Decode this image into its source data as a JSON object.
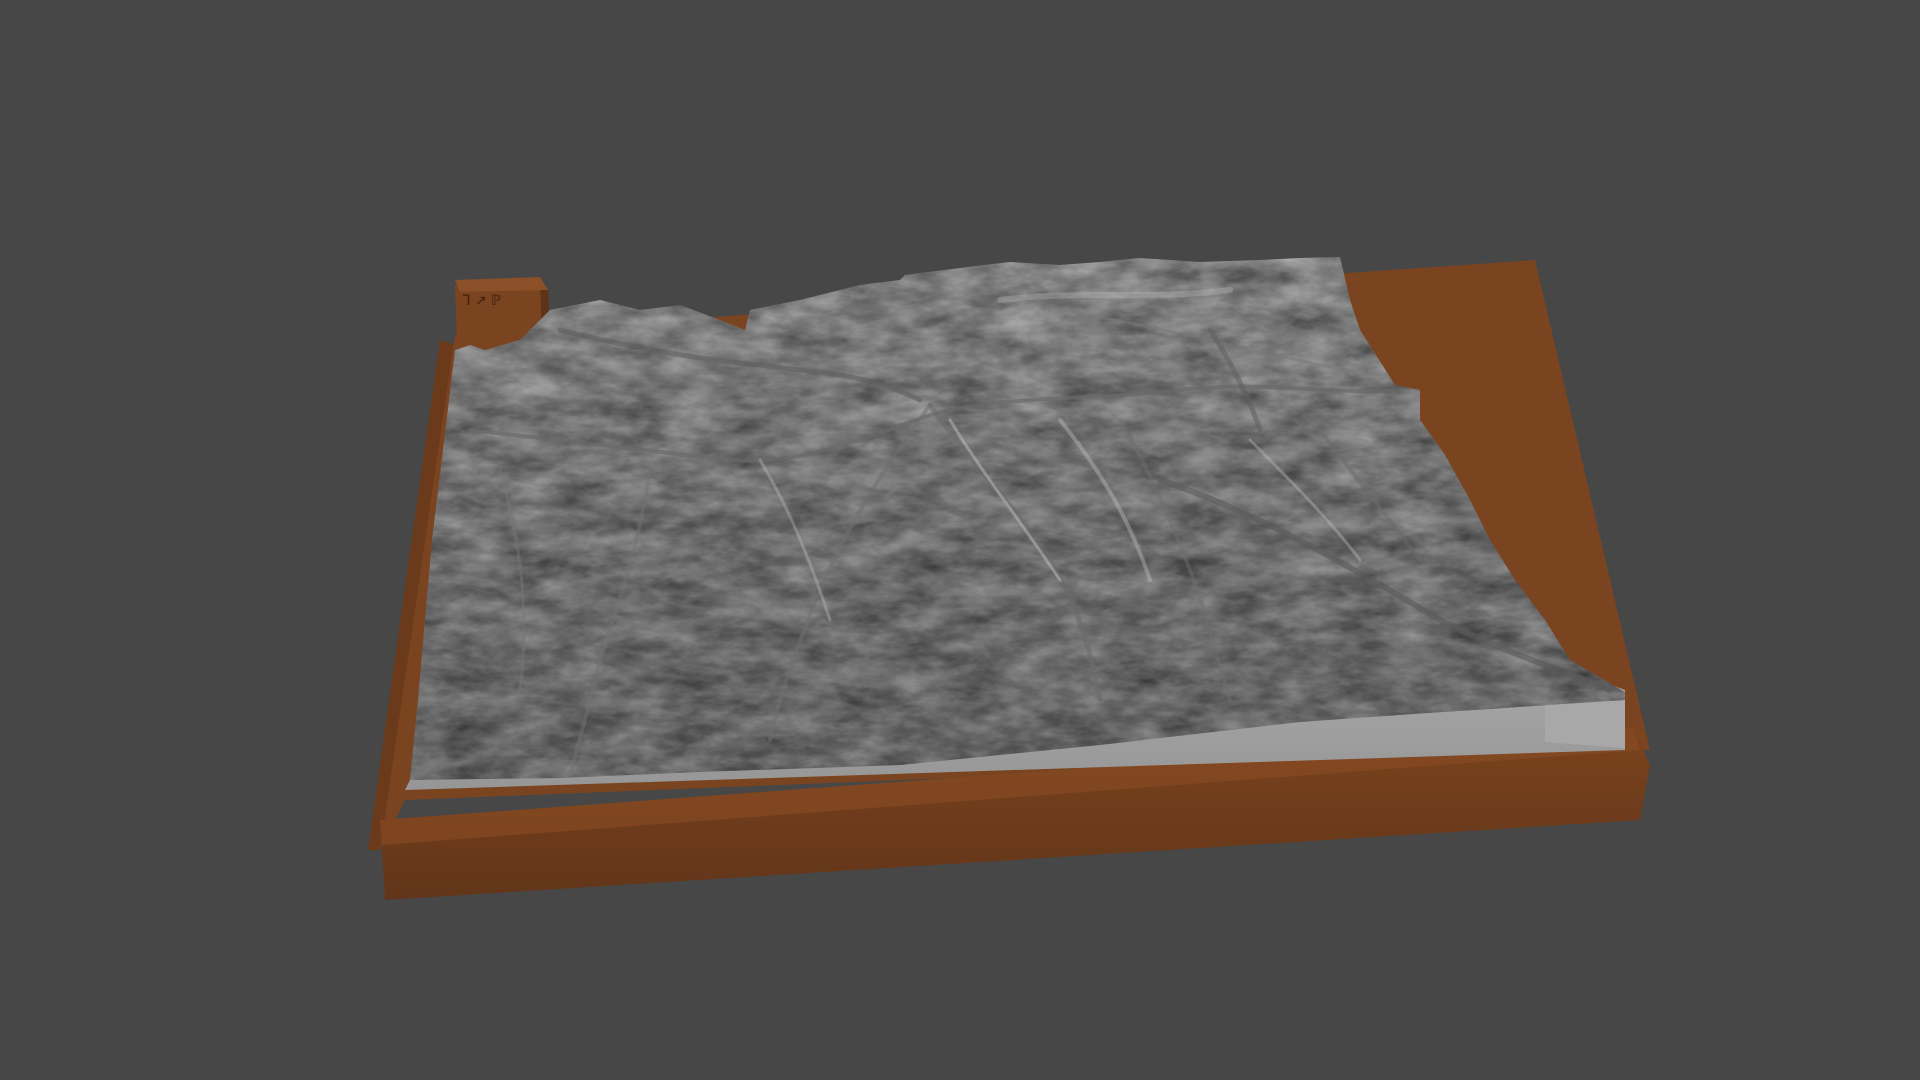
{
  "scene": {
    "description_visible_text": "",
    "background_color": "#474747",
    "model": {
      "terrain_color": "#8f8f8f",
      "base_color": "#6e3d1c",
      "base_side_color": "#5a3115",
      "ledge_color": "#9c9c9c"
    },
    "label_block": {
      "glyphs": "ᒣ ↗ ℙ"
    }
  }
}
